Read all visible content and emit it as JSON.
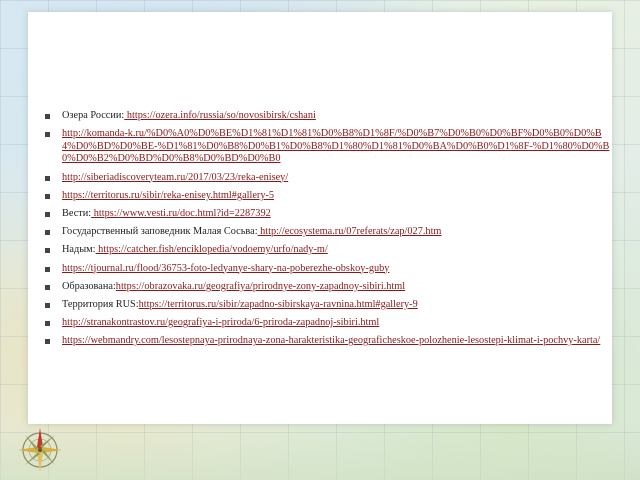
{
  "items": [
    {
      "label": "Озера России:",
      "link": " https://ozera.info/russia/so/novosibirsk/cshani"
    },
    {
      "label": "",
      "link": "http://komanda-k.ru/%D0%A0%D0%BE%D1%81%D1%81%D0%B8%D1%8F/%D0%B7%D0%B0%D0%BF%D0%B0%D0%B4%D0%BD%D0%BE-%D1%81%D0%B8%D0%B1%D0%B8%D1%80%D1%81%D0%BA%D0%B0%D1%8F-%D1%80%D0%B0%D0%B2%D0%BD%D0%B8%D0%BD%D0%B0"
    },
    {
      "label": "",
      "link": "http://siberiadiscoveryteam.ru/2017/03/23/reka-enisey/"
    },
    {
      "label": "",
      "link": "https://territorus.ru/sibir/reka-enisey.html#gallery-5"
    },
    {
      "label": "Вести:",
      "link": " https://www.vesti.ru/doc.html?id=2287392"
    },
    {
      "label": "Государственный заповедник Малая Сосьва:",
      "link": " http://ecosystema.ru/07referats/zap/027.htm"
    },
    {
      "label": "Надым:",
      "link": " https://catcher.fish/enciklopedia/vodoemy/urfo/nady-m/"
    },
    {
      "label": "",
      "link": "https://tjournal.ru/flood/36753-foto-ledyanye-shary-na-poberezhe-obskoy-guby"
    },
    {
      "label": "Образована:",
      "link": "https://obrazovaka.ru/geografiya/prirodnye-zony-zapadnoy-sibiri.html"
    },
    {
      "label": "Территория RUS:",
      "link": "https://territorus.ru/sibir/zapadno-sibirskaya-ravnina.html#gallery-9"
    },
    {
      "label": "",
      "link": "http://stranakontrastov.ru/geografiya-i-priroda/6-priroda-zapadnoj-sibiri.html"
    },
    {
      "label": "",
      "link": "https://webmandry.com/lesostepnaya-prirodnaya-zona-harakteristika-geograficheskoe-polozhenie-lesostepi-klimat-i-pochvy-karta/"
    }
  ],
  "icons": {
    "compass": "compass-rose-icon"
  },
  "colors": {
    "link": "#8a1a1a",
    "text": "#222222",
    "panel": "#ffffff"
  }
}
